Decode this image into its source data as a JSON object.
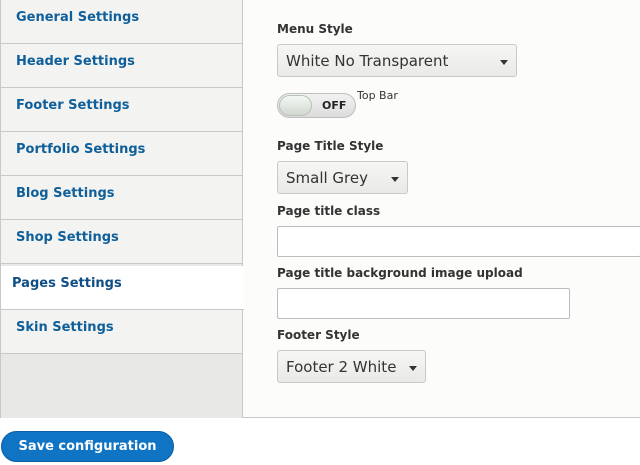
{
  "sidebar": {
    "items": [
      {
        "label": "General Settings"
      },
      {
        "label": "Header Settings"
      },
      {
        "label": "Footer Settings"
      },
      {
        "label": "Portfolio Settings"
      },
      {
        "label": "Blog Settings"
      },
      {
        "label": "Shop Settings"
      },
      {
        "label": "Pages Settings"
      },
      {
        "label": "Skin Settings"
      }
    ],
    "active_item": "Pages Settings"
  },
  "form": {
    "menu_style": {
      "label": "Menu Style",
      "value": "White No Transparent"
    },
    "top_bar": {
      "label": "Top Bar",
      "state": "OFF"
    },
    "page_title_style": {
      "label": "Page Title Style",
      "value": "Small Grey"
    },
    "page_title_class": {
      "label": "Page title class",
      "value": ""
    },
    "page_title_bg_upload": {
      "label": "Page title background image upload",
      "value": ""
    },
    "footer_style": {
      "label": "Footer Style",
      "value": "Footer 2 White"
    }
  },
  "actions": {
    "save_label": "Save configuration"
  },
  "colors": {
    "link": "#0f5f9a",
    "primary_button": "#0f74c3",
    "border": "#c8c8c8"
  }
}
